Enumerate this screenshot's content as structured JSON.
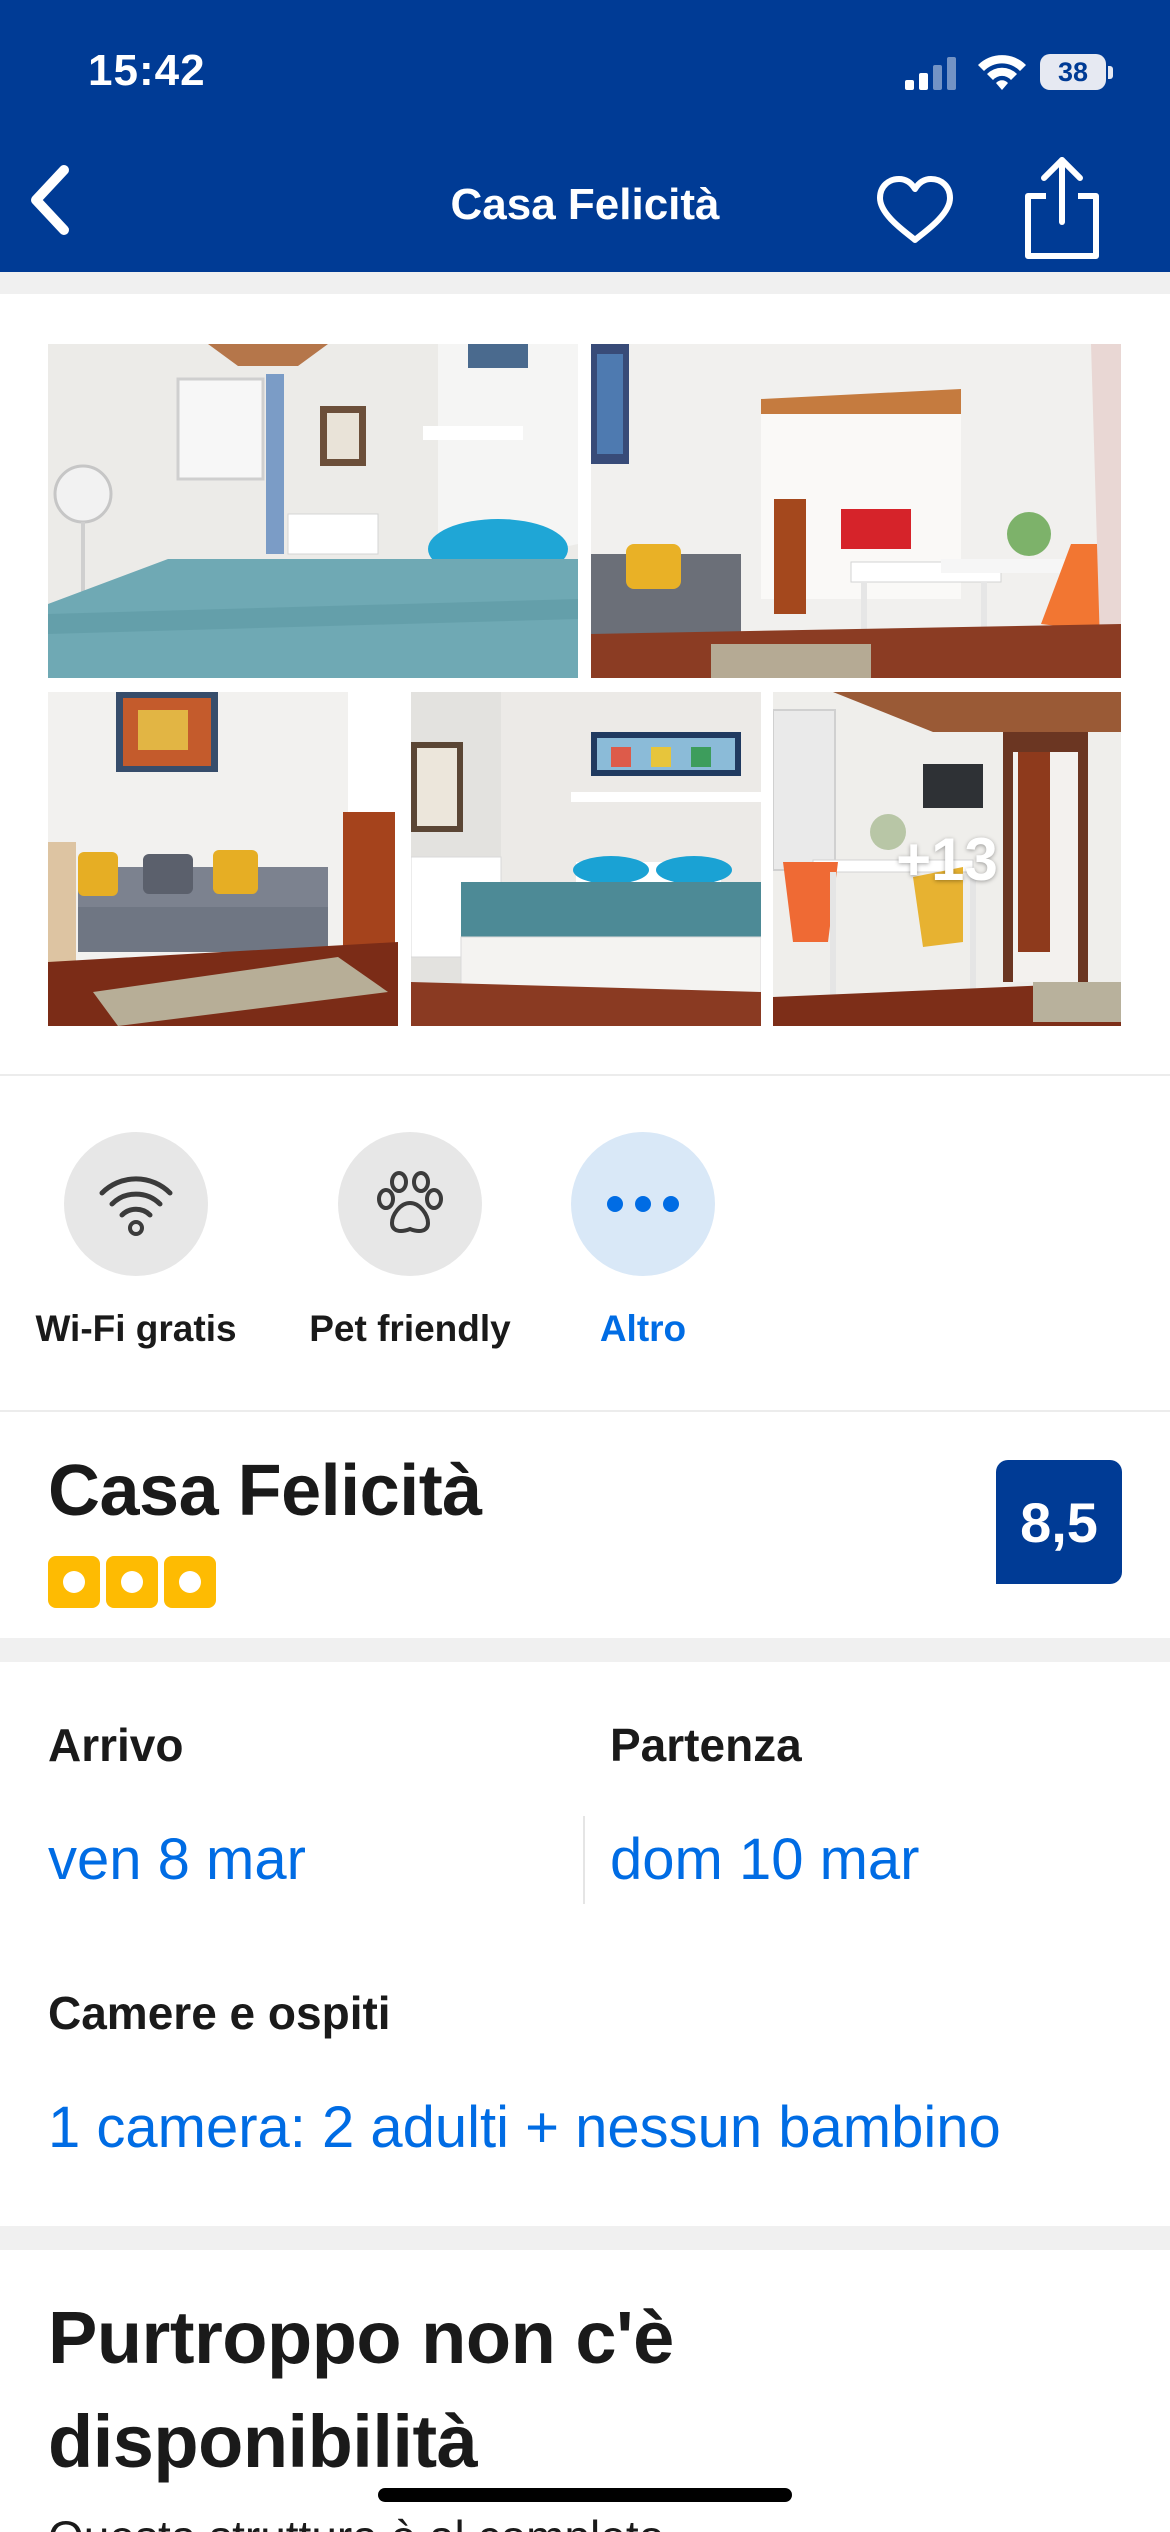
{
  "status_bar": {
    "time": "15:42",
    "battery": "38",
    "icons": [
      "cellular-signal-icon",
      "wifi-icon",
      "battery-icon"
    ]
  },
  "nav": {
    "title": "Casa Felicità",
    "icons": [
      "chevron-left-icon",
      "heart-icon",
      "share-icon"
    ]
  },
  "gallery": {
    "photos": [
      {
        "alt": "bedroom",
        "overlay": ""
      },
      {
        "alt": "living-dining",
        "overlay": ""
      },
      {
        "alt": "sofa",
        "overlay": ""
      },
      {
        "alt": "bedroom-2",
        "overlay": ""
      },
      {
        "alt": "dining-more",
        "overlay": "+13"
      }
    ]
  },
  "facilities": {
    "items": [
      {
        "icon": "wifi-icon",
        "label": "Wi-Fi gratis"
      },
      {
        "icon": "paw-icon",
        "label": "Pet friendly"
      },
      {
        "icon": "more-dots-icon",
        "label": "Altro"
      }
    ]
  },
  "property": {
    "name": "Casa Felicità",
    "stars": 3,
    "score": "8,5"
  },
  "booking": {
    "arrival_label": "Arrivo",
    "arrival_value": "ven 8 mar",
    "departure_label": "Partenza",
    "departure_value": "dom 10 mar",
    "rooms_label": "Camere e ospiti",
    "rooms_value": "1 camera: 2 adulti + nessun bambino"
  },
  "availability": {
    "title": "Purtroppo non c'è disponibilità",
    "subtitle": "Questa struttura è al completo"
  },
  "colors": {
    "brand_blue": "#003b95",
    "link_blue": "#006ce4",
    "star_yellow": "#febb02"
  }
}
